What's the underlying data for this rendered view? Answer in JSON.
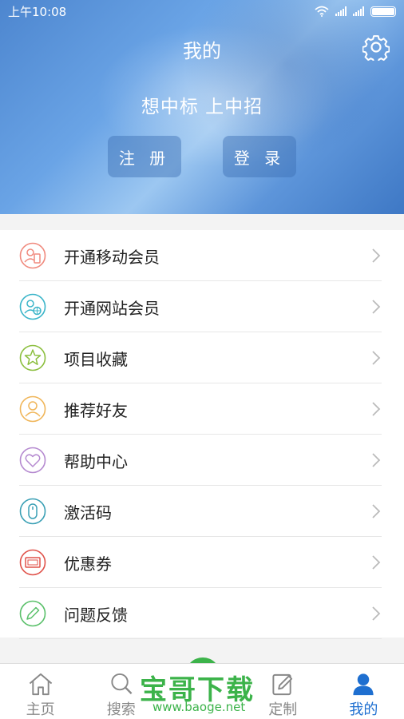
{
  "status": {
    "time": "上午10:08"
  },
  "header": {
    "title": "我的",
    "slogan": "想中标 上中招",
    "register_label": "注 册",
    "login_label": "登 录",
    "bg_color": "#5d95da"
  },
  "menu": {
    "items": [
      {
        "label": "开通移动会员",
        "icon": "mobile-member-icon",
        "color": "#f08a7e"
      },
      {
        "label": "开通网站会员",
        "icon": "web-member-icon",
        "color": "#3bb5c9"
      },
      {
        "label": "项目收藏",
        "icon": "star-icon",
        "color": "#8cbf3f"
      },
      {
        "label": "推荐好友",
        "icon": "friend-icon",
        "color": "#f0b65a"
      },
      {
        "label": "帮助中心",
        "icon": "heart-icon",
        "color": "#b58ad0"
      },
      {
        "label": "激活码",
        "icon": "mouse-icon",
        "color": "#3ba0b5"
      },
      {
        "label": "优惠券",
        "icon": "coupon-icon",
        "color": "#e0524a"
      },
      {
        "label": "问题反馈",
        "icon": "pencil-icon",
        "color": "#5ac06a"
      }
    ]
  },
  "tabs": [
    {
      "label": "主页",
      "icon": "home-icon"
    },
    {
      "label": "搜索",
      "icon": "search-icon"
    },
    {
      "label": "",
      "icon": "center-icon"
    },
    {
      "label": "定制",
      "icon": "edit-icon"
    },
    {
      "label": "我的",
      "icon": "user-icon",
      "active": true
    }
  ],
  "watermark": {
    "title": "宝哥下载",
    "url": "www.baoge.net"
  },
  "colors": {
    "accent": "#1e6fd0",
    "watermark": "#3cb34a"
  }
}
